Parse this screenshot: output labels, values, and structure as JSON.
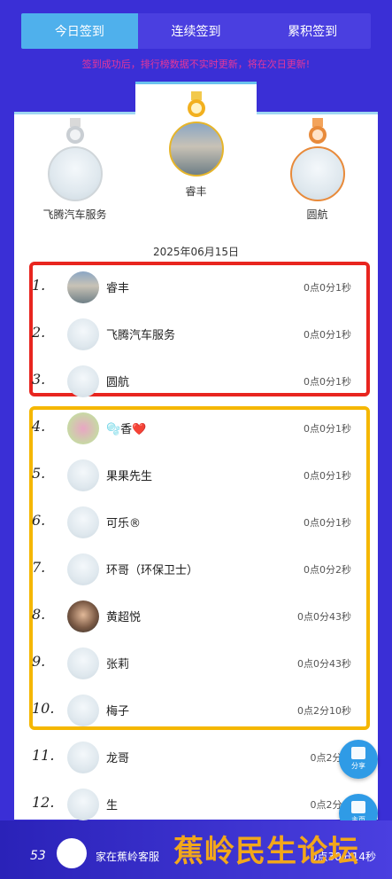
{
  "tabs": [
    {
      "label": "今日签到",
      "active": true
    },
    {
      "label": "连续签到",
      "active": false
    },
    {
      "label": "累积签到",
      "active": false
    }
  ],
  "notice": "签到成功后，排行榜数据不实时更新，将在次日更新!",
  "podium": {
    "first": {
      "name": "睿丰",
      "medal": "gold-medal-icon"
    },
    "second": {
      "name": "飞腾汽车服务",
      "medal": "silver-medal-icon"
    },
    "third": {
      "name": "圆航",
      "medal": "bronze-medal-icon"
    }
  },
  "date": "2025年06月15日",
  "rows": [
    {
      "rank": "1.",
      "name": "睿丰",
      "time": "0点0分1秒"
    },
    {
      "rank": "2.",
      "name": "飞腾汽车服务",
      "time": "0点0分1秒"
    },
    {
      "rank": "3.",
      "name": "圆航",
      "time": "0点0分1秒"
    },
    {
      "rank": "4.",
      "name": "🫧香❤️",
      "time": "0点0分1秒"
    },
    {
      "rank": "5.",
      "name": "果果先生",
      "time": "0点0分1秒"
    },
    {
      "rank": "6.",
      "name": "可乐®",
      "time": "0点0分1秒"
    },
    {
      "rank": "7.",
      "name": "环哥（环保卫士）",
      "time": "0点0分2秒"
    },
    {
      "rank": "8.",
      "name": "黄超悦",
      "time": "0点0分43秒"
    },
    {
      "rank": "9.",
      "name": "张莉",
      "time": "0点0分43秒"
    },
    {
      "rank": "10.",
      "name": "梅子",
      "time": "0点2分10秒"
    },
    {
      "rank": "11.",
      "name": "龙哥",
      "time": "0点2分..."
    },
    {
      "rank": "12.",
      "name": "生",
      "time": "0点2分..."
    }
  ],
  "fab": {
    "share_label": "分享",
    "home_label": "主页"
  },
  "bottom": {
    "rank": "53",
    "name": "家在蕉岭客服",
    "time": "0点30分14秒"
  },
  "watermark": "蕉岭民生论坛",
  "colors": {
    "accent": "#4fb0ec",
    "background": "#3a2fd6",
    "red_box": "#e8251f",
    "yellow_box": "#f5b700"
  }
}
